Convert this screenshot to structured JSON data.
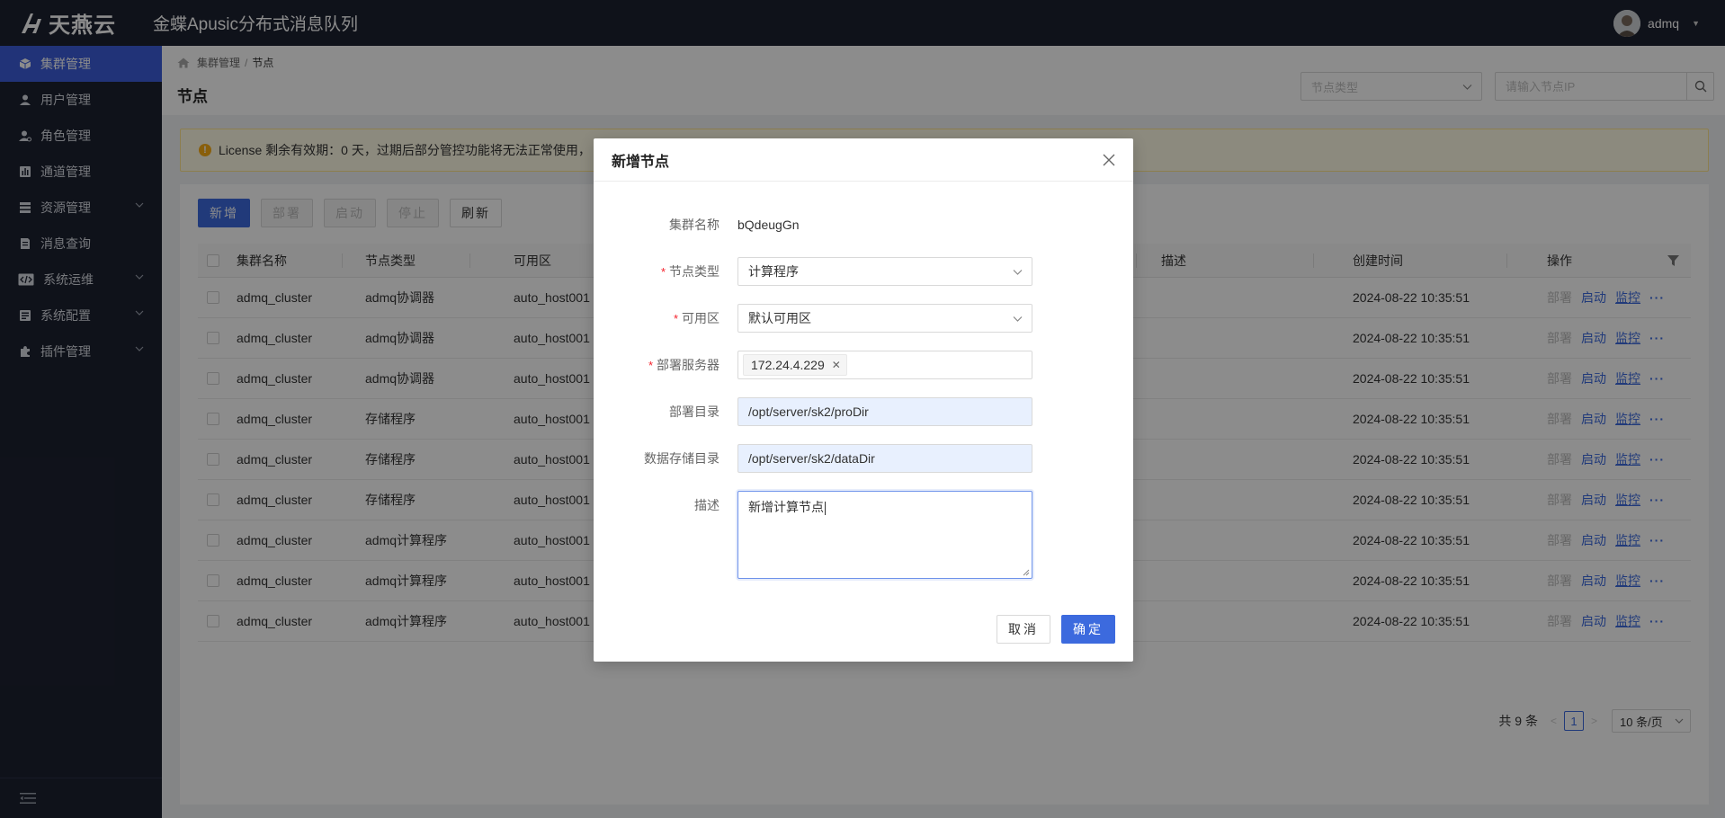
{
  "header": {
    "logo_text": "天燕云",
    "app_title": "金蝶Apusic分布式消息队列",
    "username": "admq"
  },
  "sidebar": {
    "items": [
      {
        "label": "集群管理",
        "icon": "cube-icon",
        "active": true,
        "expandable": false
      },
      {
        "label": "用户管理",
        "icon": "user-icon",
        "active": false,
        "expandable": false
      },
      {
        "label": "角色管理",
        "icon": "role-icon",
        "active": false,
        "expandable": false
      },
      {
        "label": "通道管理",
        "icon": "channel-icon",
        "active": false,
        "expandable": false
      },
      {
        "label": "资源管理",
        "icon": "resource-icon",
        "active": false,
        "expandable": true
      },
      {
        "label": "消息查询",
        "icon": "message-icon",
        "active": false,
        "expandable": false
      },
      {
        "label": "系统运维",
        "icon": "code-icon",
        "active": false,
        "expandable": true
      },
      {
        "label": "系统配置",
        "icon": "config-icon",
        "active": false,
        "expandable": true
      },
      {
        "label": "插件管理",
        "icon": "plugin-icon",
        "active": false,
        "expandable": true
      }
    ]
  },
  "breadcrumb": {
    "parent": "集群管理",
    "separator": "/",
    "current": "节点"
  },
  "page": {
    "title": "节点",
    "filter_placeholder": "节点类型",
    "search_placeholder": "请输入节点IP"
  },
  "license": {
    "text": "License 剩余有效期：0 天，过期后部分管控功能将无法正常使用，"
  },
  "toolbar": {
    "add": "新增",
    "deploy": "部署",
    "start": "启动",
    "stop": "停止",
    "refresh": "刷新"
  },
  "table": {
    "headers": {
      "cluster": "集群名称",
      "type": "节点类型",
      "zone": "可用区",
      "desc": "描述",
      "created": "创建时间",
      "ops": "操作"
    },
    "op_labels": {
      "deploy": "部署",
      "start": "启动",
      "monitor": "监控",
      "more": "···"
    },
    "rows": [
      {
        "cluster": "admq_cluster",
        "type": "admq协调器",
        "zone": "auto_host001",
        "created": "2024-08-22 10:35:51"
      },
      {
        "cluster": "admq_cluster",
        "type": "admq协调器",
        "zone": "auto_host001",
        "created": "2024-08-22 10:35:51"
      },
      {
        "cluster": "admq_cluster",
        "type": "admq协调器",
        "zone": "auto_host001",
        "created": "2024-08-22 10:35:51"
      },
      {
        "cluster": "admq_cluster",
        "type": "存储程序",
        "zone": "auto_host001",
        "created": "2024-08-22 10:35:51"
      },
      {
        "cluster": "admq_cluster",
        "type": "存储程序",
        "zone": "auto_host001",
        "created": "2024-08-22 10:35:51"
      },
      {
        "cluster": "admq_cluster",
        "type": "存储程序",
        "zone": "auto_host001",
        "created": "2024-08-22 10:35:51"
      },
      {
        "cluster": "admq_cluster",
        "type": "admq计算程序",
        "zone": "auto_host001",
        "created": "2024-08-22 10:35:51"
      },
      {
        "cluster": "admq_cluster",
        "type": "admq计算程序",
        "zone": "auto_host001",
        "created": "2024-08-22 10:35:51"
      },
      {
        "cluster": "admq_cluster",
        "type": "admq计算程序",
        "zone": "auto_host001",
        "created": "2024-08-22 10:35:51"
      }
    ]
  },
  "pagination": {
    "total": "共 9 条",
    "page": "1",
    "prev": "<",
    "next": ">",
    "page_size": "10 条/页"
  },
  "modal": {
    "title": "新增节点",
    "fields": {
      "cluster_name_label": "集群名称",
      "cluster_name_value": "bQdeugGn",
      "node_type_label": "节点类型",
      "node_type_value": "计算程序",
      "zone_label": "可用区",
      "zone_value": "默认可用区",
      "servers_label": "部署服务器",
      "server_tag": "172.24.4.229",
      "deploy_dir_label": "部署目录",
      "deploy_dir_value": "/opt/server/sk2/proDir",
      "data_dir_label": "数据存储目录",
      "data_dir_value": "/opt/server/sk2/dataDir",
      "desc_label": "描述",
      "desc_value": "新增计算节点"
    },
    "required_mark": "*",
    "cancel": "取消",
    "ok": "确定"
  },
  "colors": {
    "primary": "#3c6ade",
    "sidebar_bg": "#1d2131",
    "required": "#f5222d",
    "warning": "#faad14"
  }
}
